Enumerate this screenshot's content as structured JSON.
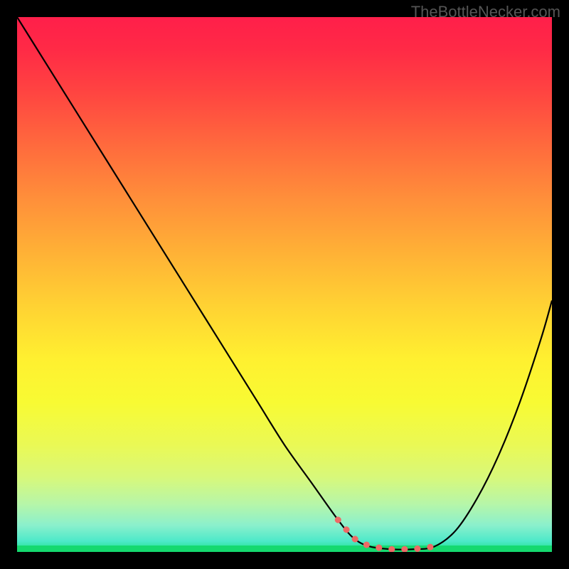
{
  "watermark": "TheBottleNecker.com",
  "chart_data": {
    "type": "line",
    "title": "",
    "xlabel": "",
    "ylabel": "",
    "xlim": [
      0,
      100
    ],
    "ylim": [
      0,
      100
    ],
    "description": "Bottleneck curve: vertical axis = bottleneck % (100 at top, 0 at bottom); horizontal axis = relative hardware pairing position. Background gradient encodes severity (red=high bottleneck, green=none).",
    "series": [
      {
        "name": "bottleneck-curve",
        "x": [
          0,
          5,
          10,
          15,
          20,
          25,
          30,
          35,
          40,
          45,
          50,
          55,
          60,
          63,
          66,
          70,
          74,
          78,
          82,
          86,
          90,
          94,
          98,
          100
        ],
        "y": [
          100,
          92,
          84,
          76,
          68,
          60,
          52,
          44,
          36,
          28,
          20,
          13,
          6,
          2.5,
          1,
          0.5,
          0.5,
          1,
          4,
          10,
          18,
          28,
          40,
          47
        ]
      }
    ],
    "optimal_range": {
      "x_start": 58,
      "x_end": 80,
      "y": 2
    },
    "gradient_stops": [
      {
        "pct": 0,
        "color": "#ff1f4a"
      },
      {
        "pct": 50,
        "color": "#ffd233"
      },
      {
        "pct": 100,
        "color": "#19e27d"
      }
    ]
  }
}
